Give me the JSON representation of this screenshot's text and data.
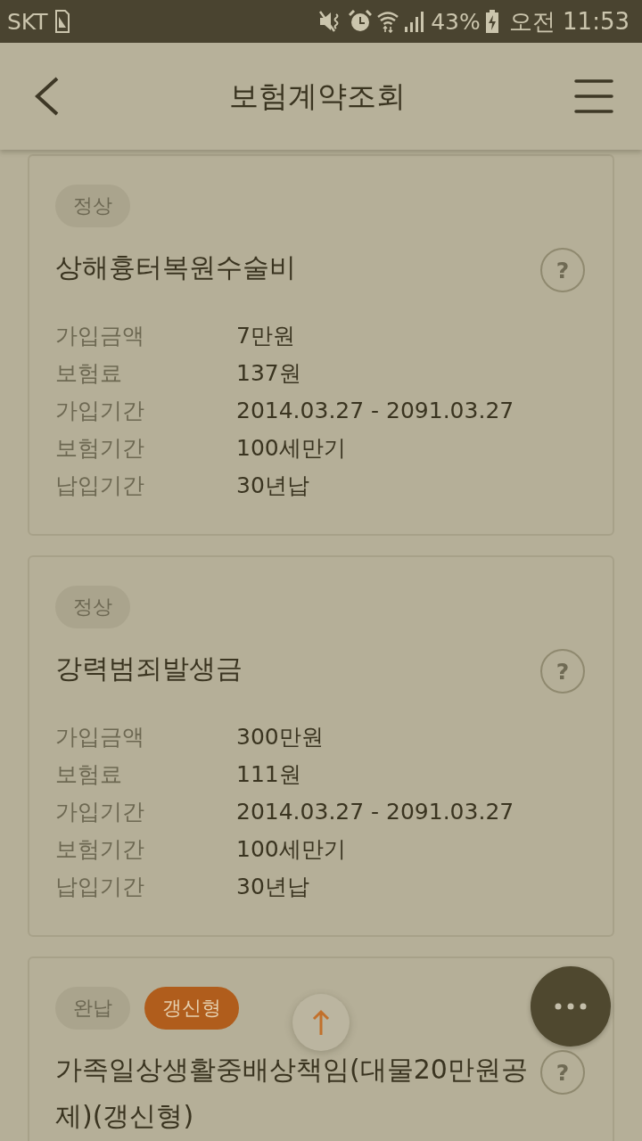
{
  "status_bar": {
    "carrier": "SKT",
    "battery": "43%",
    "time": "오전 11:53"
  },
  "header": {
    "title": "보험계약조회"
  },
  "contracts": [
    {
      "badges": [
        {
          "label": "정상",
          "kind": "neutral"
        }
      ],
      "name": "상해흉터복원수술비",
      "help": "?",
      "details": [
        {
          "label": "가입금액",
          "value": "7만원"
        },
        {
          "label": "보험료",
          "value": "137원"
        },
        {
          "label": "가입기간",
          "value": "2014.03.27 - 2091.03.27"
        },
        {
          "label": "보험기간",
          "value": "100세만기"
        },
        {
          "label": "납입기간",
          "value": "30년납"
        }
      ]
    },
    {
      "badges": [
        {
          "label": "정상",
          "kind": "neutral"
        }
      ],
      "name": "강력범죄발생금",
      "help": "?",
      "details": [
        {
          "label": "가입금액",
          "value": "300만원"
        },
        {
          "label": "보험료",
          "value": "111원"
        },
        {
          "label": "가입기간",
          "value": "2014.03.27 - 2091.03.27"
        },
        {
          "label": "보험기간",
          "value": "100세만기"
        },
        {
          "label": "납입기간",
          "value": "30년납"
        }
      ]
    },
    {
      "badges": [
        {
          "label": "완납",
          "kind": "neutral"
        },
        {
          "label": "갱신형",
          "kind": "accent"
        }
      ],
      "name": "가족일상생활중배상책임(대물20만원공제)(갱신형)",
      "help": "?"
    }
  ]
}
